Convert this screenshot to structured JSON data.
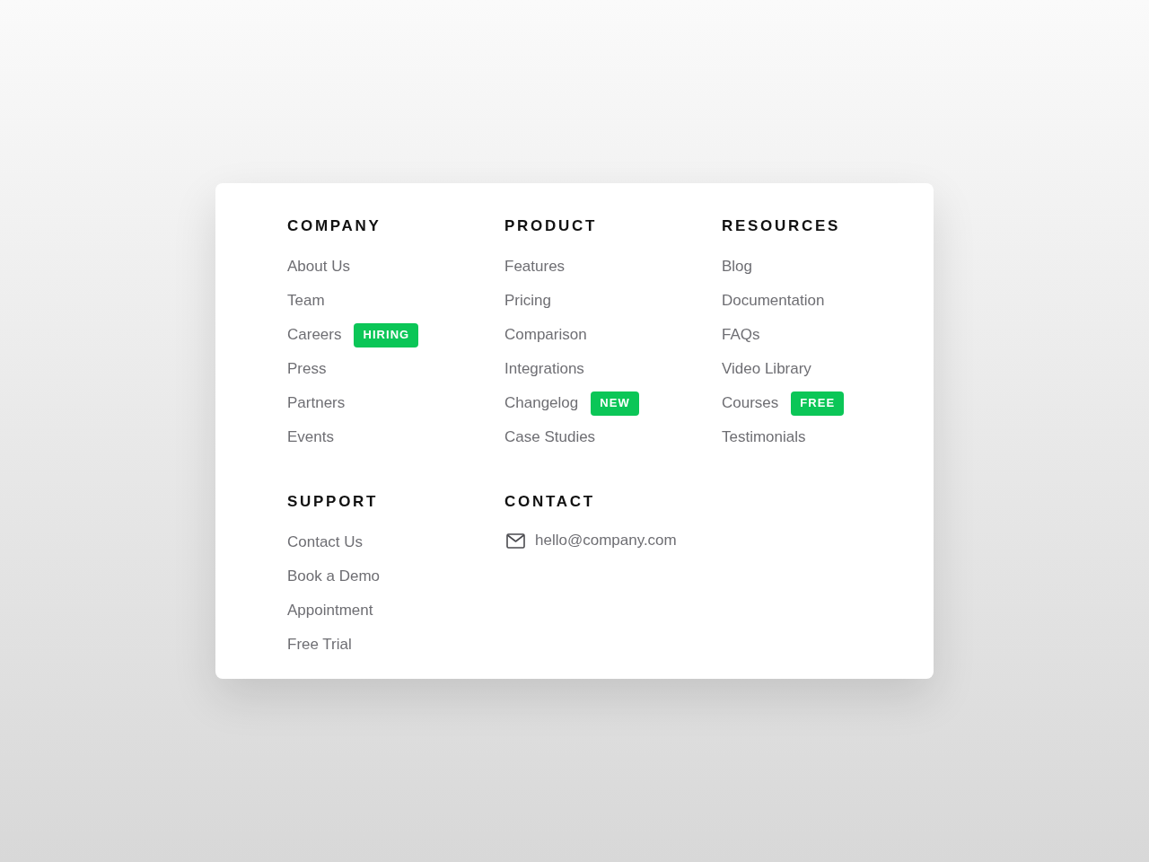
{
  "sections": [
    {
      "kind": "links",
      "title": "COMPANY",
      "links": [
        {
          "label": "About Us"
        },
        {
          "label": "Team"
        },
        {
          "label": "Careers",
          "badge": "HIRING"
        },
        {
          "label": "Press"
        },
        {
          "label": "Partners"
        },
        {
          "label": "Events"
        }
      ]
    },
    {
      "kind": "links",
      "title": "PRODUCT",
      "links": [
        {
          "label": "Features"
        },
        {
          "label": "Pricing"
        },
        {
          "label": "Comparison"
        },
        {
          "label": "Integrations"
        },
        {
          "label": "Changelog",
          "badge": "NEW"
        },
        {
          "label": "Case Studies"
        }
      ]
    },
    {
      "kind": "links",
      "title": "RESOURCES",
      "links": [
        {
          "label": "Blog"
        },
        {
          "label": "Documentation"
        },
        {
          "label": "FAQs"
        },
        {
          "label": "Video Library"
        },
        {
          "label": "Courses",
          "badge": "FREE"
        },
        {
          "label": "Testimonials"
        }
      ]
    },
    {
      "kind": "links",
      "title": "SUPPORT",
      "links": [
        {
          "label": "Contact Us"
        },
        {
          "label": "Book a Demo"
        },
        {
          "label": "Appointment"
        },
        {
          "label": "Free Trial"
        }
      ]
    },
    {
      "kind": "contact",
      "title": "CONTACT",
      "email": "hello@company.com"
    }
  ]
}
